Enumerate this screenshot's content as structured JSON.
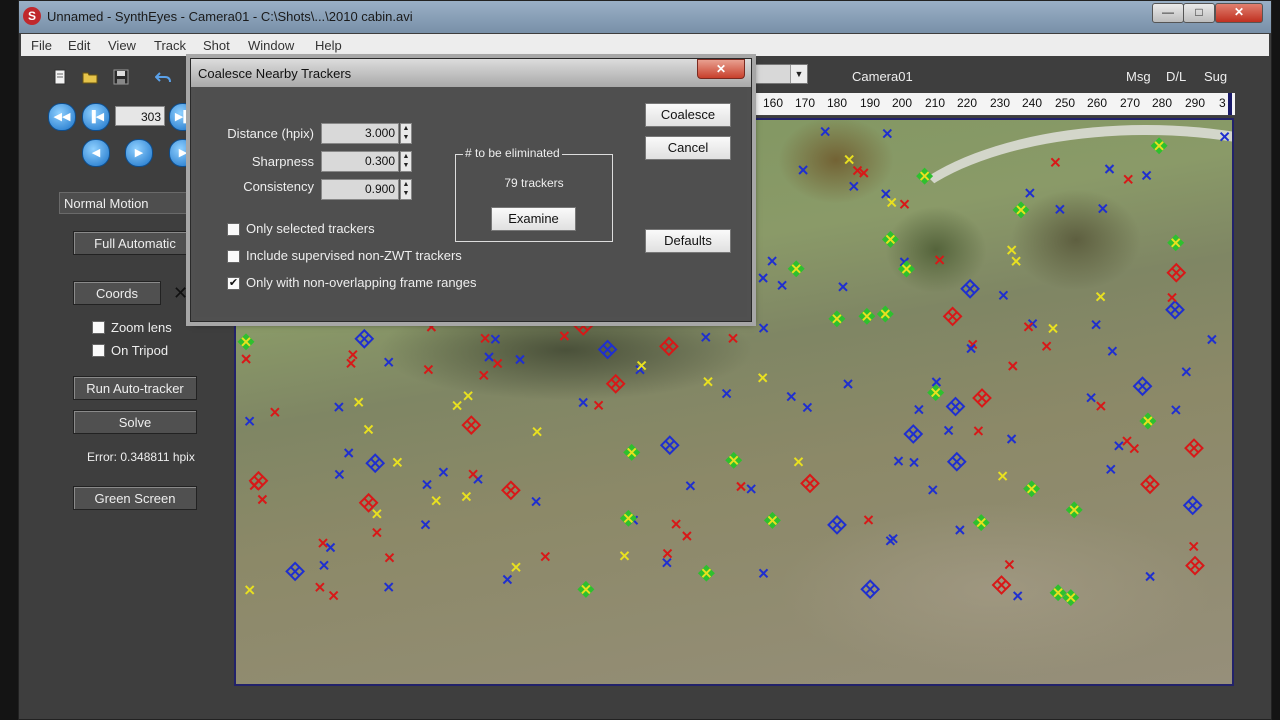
{
  "window": {
    "title": "Unnamed - SynthEyes - Camera01 - C:\\Shots\\...\\2010 cabin.avi",
    "controls": [
      "—",
      "□",
      "✕"
    ]
  },
  "menu": [
    "File",
    "Edit",
    "View",
    "Track",
    "Shot",
    "Window",
    "Help"
  ],
  "toolbar": {
    "icons": [
      "new-file-icon",
      "open-folder-icon",
      "save-icon",
      "undo-icon"
    ]
  },
  "playback": {
    "frame": "303",
    "row1": [
      "◀◀",
      "▐◀",
      "▶▌"
    ],
    "row2": [
      "◀",
      "▶",
      "▶"
    ]
  },
  "left_panel": {
    "motion_mode": "Normal Motion",
    "full_automatic": "Full Automatic",
    "coords": "Coords",
    "coords_clear": "✕",
    "zoom_lens": "Zoom lens",
    "on_tripod": "On Tripod",
    "run_autotracker": "Run Auto-tracker",
    "solve": "Solve",
    "error": "Error: 0.348811 hpix",
    "green_screen": "Green Screen"
  },
  "viewport_top": {
    "camera": "Camera01",
    "msg": "Msg",
    "dl": "D/L",
    "sug": "Sug"
  },
  "timeline": {
    "ticks": [
      "160",
      "170",
      "180",
      "190",
      "200",
      "210",
      "220",
      "230",
      "240",
      "250",
      "260",
      "270",
      "280",
      "290",
      "3"
    ]
  },
  "dialog": {
    "title": "Coalesce Nearby Trackers",
    "close": "✕",
    "distance_label": "Distance (hpix)",
    "distance": "3.000",
    "sharpness_label": "Sharpness",
    "sharpness": "0.300",
    "consistency_label": "Consistency",
    "consistency": "0.900",
    "group_title": "# to be eliminated",
    "eliminated": "79 trackers",
    "examine": "Examine",
    "coalesce": "Coalesce",
    "cancel": "Cancel",
    "defaults": "Defaults",
    "options": [
      {
        "label": "Only selected trackers",
        "checked": false
      },
      {
        "label": "Include supervised non-ZWT trackers",
        "checked": false
      },
      {
        "label": "Only with non-overlapping frame ranges",
        "checked": true
      }
    ]
  },
  "colors": {
    "tracker_blue": "#1f2fd0",
    "tracker_red": "#d81818",
    "tracker_yellow": "#e8e020",
    "tracker_green": "#2ec02e"
  }
}
